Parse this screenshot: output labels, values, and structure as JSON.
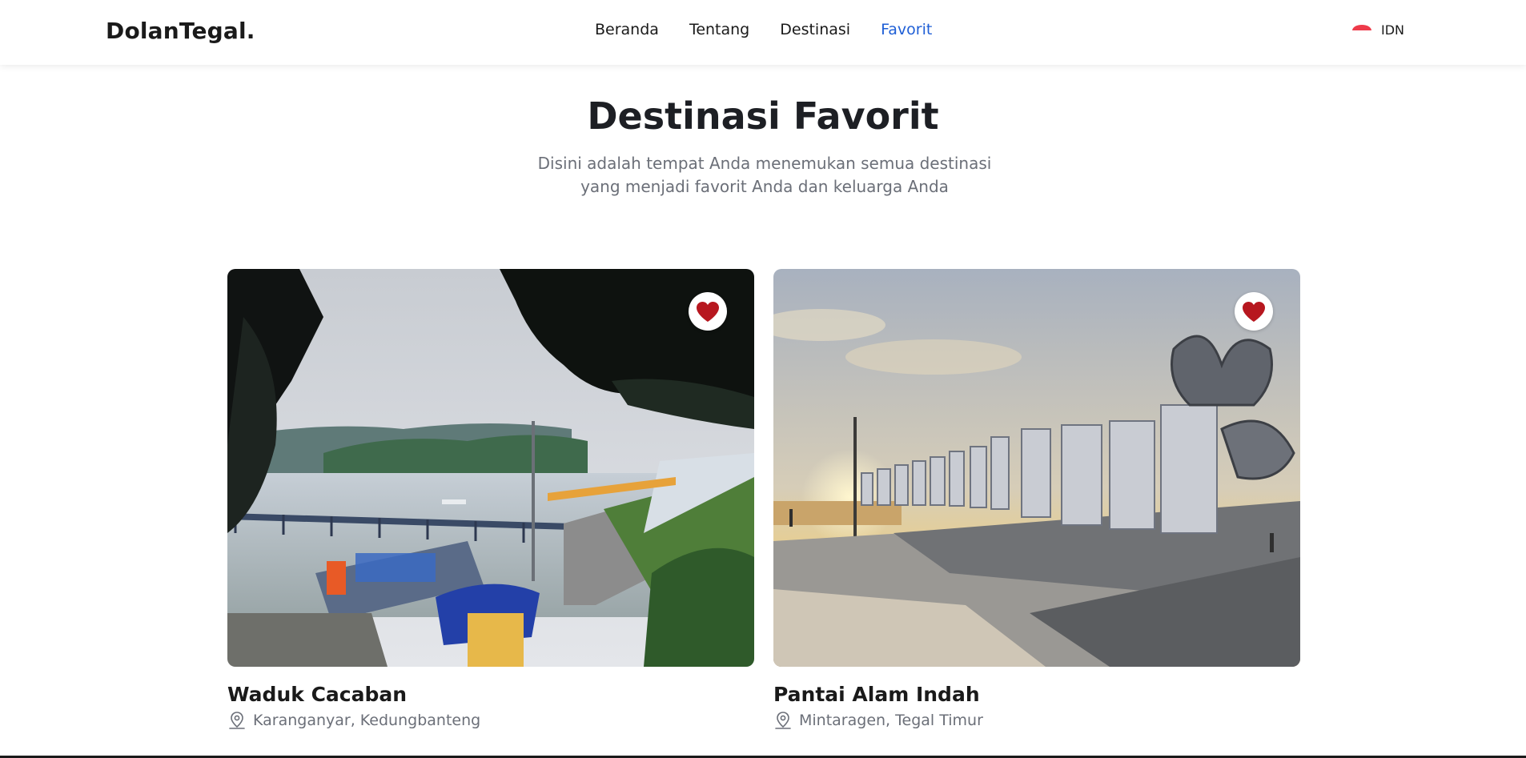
{
  "brand": "DolanTegal.",
  "nav": {
    "items": [
      {
        "label": "Beranda"
      },
      {
        "label": "Tentang"
      },
      {
        "label": "Destinasi"
      },
      {
        "label": "Favorit"
      }
    ],
    "active": "Favorit",
    "active_color": "#1f5fd6"
  },
  "language": {
    "label": "IDN",
    "flag_icon": "indonesia-flag-icon"
  },
  "hero": {
    "title": "Destinasi Favorit",
    "subtitle": "Disini adalah tempat Anda menemukan semua destinasi yang menjadi favorit Anda dan keluarga Anda"
  },
  "cards": [
    {
      "title": "Waduk Cacaban",
      "location": "Karanganyar, Kedungbanteng",
      "favorite": true
    },
    {
      "title": "Pantai Alam Indah",
      "location": "Mintaragen, Tegal Timur",
      "favorite": true
    }
  ],
  "colors": {
    "heart": "#b7171f",
    "text_muted": "#6b6f78"
  }
}
